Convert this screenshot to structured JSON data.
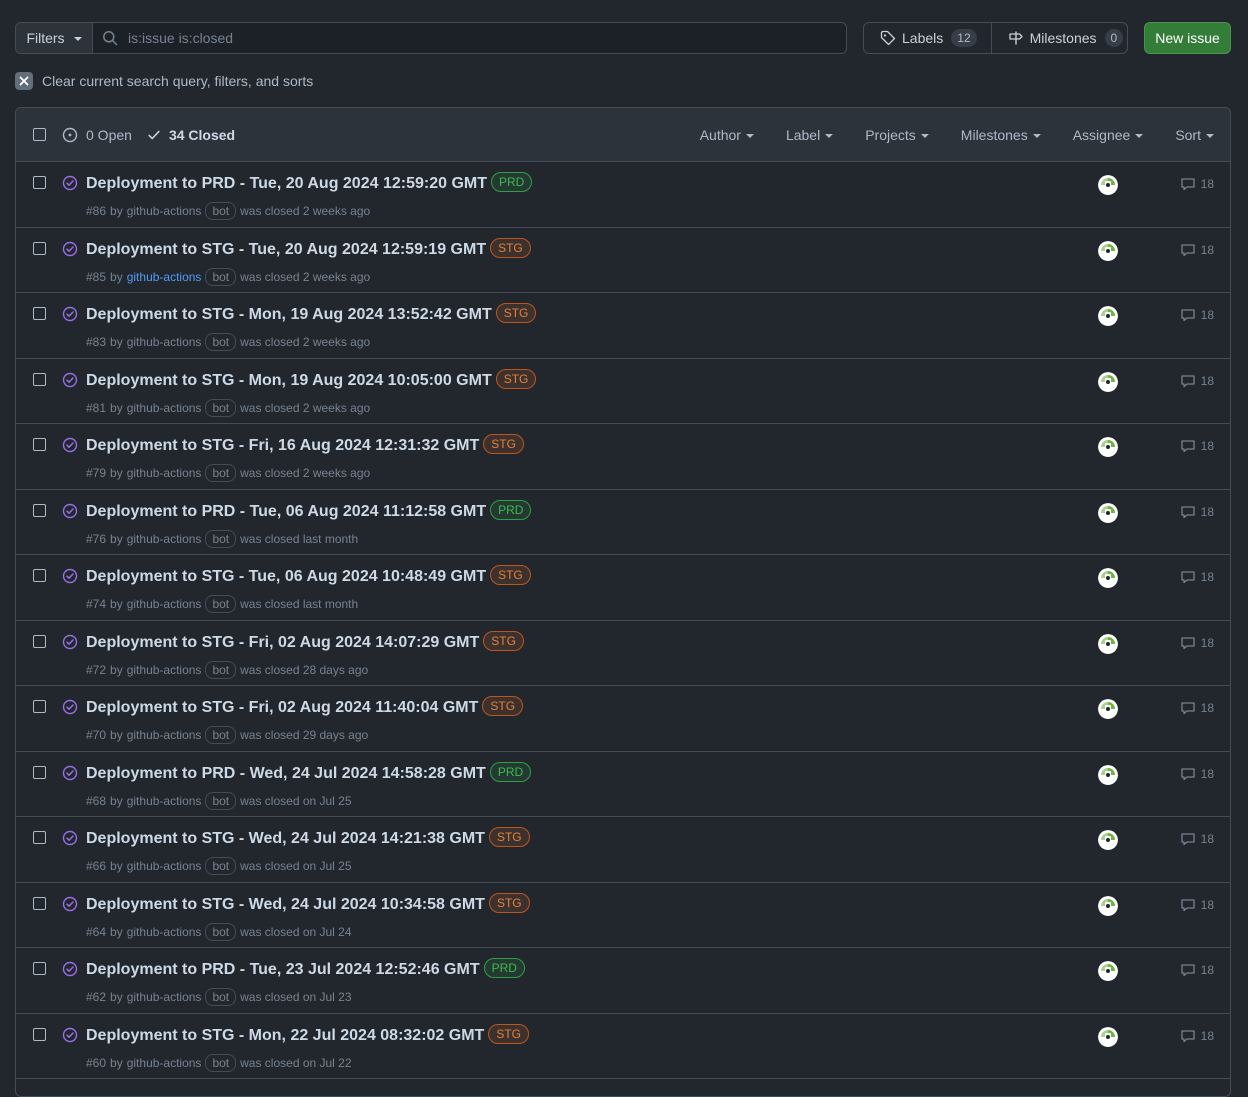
{
  "toolbar": {
    "filters_label": "Filters",
    "search_value": "is:issue is:closed",
    "labels_label": "Labels",
    "labels_count": "12",
    "milestones_label": "Milestones",
    "milestones_count": "0",
    "new_issue_label": "New issue"
  },
  "clear_filters_label": "Clear current search query, filters, and sorts",
  "list_header": {
    "open_label": "0 Open",
    "closed_label": "34 Closed",
    "menus": [
      "Author",
      "Label",
      "Projects",
      "Milestones",
      "Assignee",
      "Sort"
    ]
  },
  "issues": [
    {
      "title": "Deployment to PRD - Tue, 20 Aug 2024 12:59:20 GMT",
      "label": "PRD",
      "number": "#86",
      "by": "by",
      "author": "github-actions",
      "bot": "bot",
      "closed": "was closed 2 weeks ago",
      "comments": "18"
    },
    {
      "title": "Deployment to STG - Tue, 20 Aug 2024 12:59:19 GMT",
      "label": "STG",
      "number": "#85",
      "by": "by",
      "author": "github-actions",
      "bot": "bot",
      "closed": "was closed 2 weeks ago",
      "comments": "18"
    },
    {
      "title": "Deployment to STG - Mon, 19 Aug 2024 13:52:42 GMT",
      "label": "STG",
      "number": "#83",
      "by": "by",
      "author": "github-actions",
      "bot": "bot",
      "closed": "was closed 2 weeks ago",
      "comments": "18"
    },
    {
      "title": "Deployment to STG - Mon, 19 Aug 2024 10:05:00 GMT",
      "label": "STG",
      "number": "#81",
      "by": "by",
      "author": "github-actions",
      "bot": "bot",
      "closed": "was closed 2 weeks ago",
      "comments": "18"
    },
    {
      "title": "Deployment to STG - Fri, 16 Aug 2024 12:31:32 GMT",
      "label": "STG",
      "number": "#79",
      "by": "by",
      "author": "github-actions",
      "bot": "bot",
      "closed": "was closed 2 weeks ago",
      "comments": "18"
    },
    {
      "title": "Deployment to PRD - Tue, 06 Aug 2024 11:12:58 GMT",
      "label": "PRD",
      "number": "#76",
      "by": "by",
      "author": "github-actions",
      "bot": "bot",
      "closed": "was closed last month",
      "comments": "18"
    },
    {
      "title": "Deployment to STG - Tue, 06 Aug 2024 10:48:49 GMT",
      "label": "STG",
      "number": "#74",
      "by": "by",
      "author": "github-actions",
      "bot": "bot",
      "closed": "was closed last month",
      "comments": "18"
    },
    {
      "title": "Deployment to STG - Fri, 02 Aug 2024 14:07:29 GMT",
      "label": "STG",
      "number": "#72",
      "by": "by",
      "author": "github-actions",
      "bot": "bot",
      "closed": "was closed 28 days ago",
      "comments": "18"
    },
    {
      "title": "Deployment to STG - Fri, 02 Aug 2024 11:40:04 GMT",
      "label": "STG",
      "number": "#70",
      "by": "by",
      "author": "github-actions",
      "bot": "bot",
      "closed": "was closed 29 days ago",
      "comments": "18"
    },
    {
      "title": "Deployment to PRD - Wed, 24 Jul 2024 14:58:28 GMT",
      "label": "PRD",
      "number": "#68",
      "by": "by",
      "author": "github-actions",
      "bot": "bot",
      "closed": "was closed on Jul 25",
      "comments": "18"
    },
    {
      "title": "Deployment to STG - Wed, 24 Jul 2024 14:21:38 GMT",
      "label": "STG",
      "number": "#66",
      "by": "by",
      "author": "github-actions",
      "bot": "bot",
      "closed": "was closed on Jul 25",
      "comments": "18"
    },
    {
      "title": "Deployment to STG - Wed, 24 Jul 2024 10:34:58 GMT",
      "label": "STG",
      "number": "#64",
      "by": "by",
      "author": "github-actions",
      "bot": "bot",
      "closed": "was closed on Jul 24",
      "comments": "18"
    },
    {
      "title": "Deployment to PRD - Tue, 23 Jul 2024 12:52:46 GMT",
      "label": "PRD",
      "number": "#62",
      "by": "by",
      "author": "github-actions",
      "bot": "bot",
      "closed": "was closed on Jul 23",
      "comments": "18"
    },
    {
      "title": "Deployment to STG - Mon, 22 Jul 2024 08:32:02 GMT",
      "label": "STG",
      "number": "#60",
      "by": "by",
      "author": "github-actions",
      "bot": "bot",
      "closed": "was closed on Jul 22",
      "comments": "18"
    }
  ],
  "icons": {
    "closed_issue": "issue-closed-icon",
    "comment": "comment-icon",
    "assignee_avatar": "avatar-icon",
    "search": "search-icon",
    "tag": "tag-icon",
    "milestone": "milestone-icon"
  },
  "colors": {
    "background": "#22272e",
    "closed_icon": "#986ee2",
    "new_issue_bg": "#347d39",
    "prd_label": "#3fb950",
    "stg_label": "#e0823d",
    "link": "#539bf5"
  }
}
